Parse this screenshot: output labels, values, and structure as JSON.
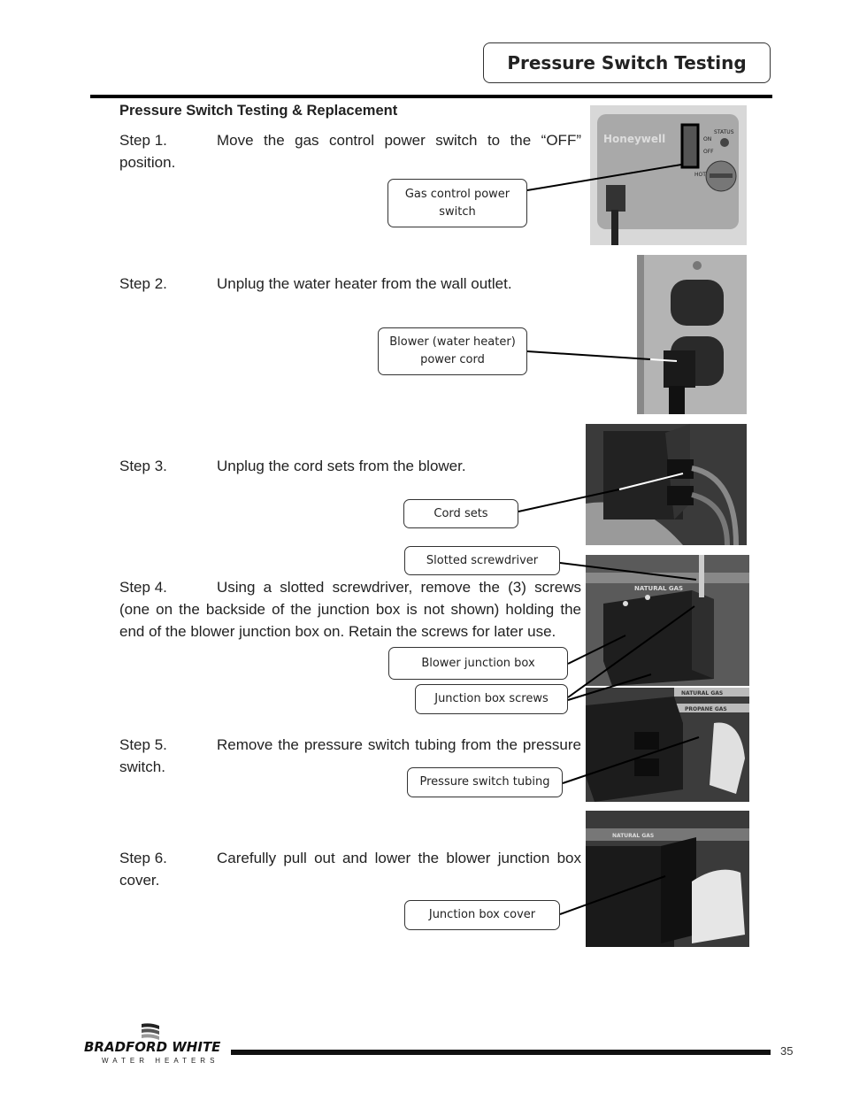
{
  "header": {
    "title": "Pressure Switch Testing"
  },
  "section": {
    "heading": "Pressure Switch Testing & Replacement"
  },
  "steps": [
    {
      "num": "Step 1.",
      "text": "Move the gas control power switch to the “OFF” position."
    },
    {
      "num": "Step 2.",
      "text": "Unplug the water heater from the wall outlet."
    },
    {
      "num": "Step 3.",
      "text": "Unplug the cord sets from the blower."
    },
    {
      "num": "Step 4.",
      "text": "Using a slotted screwdriver, remove the  (3) screws (one on the backside of the junction box is not shown) holding the end of the blower junction box on.  Retain the screws for later use."
    },
    {
      "num": "Step 5.",
      "text": "Remove the pressure switch tubing from the pressure switch."
    },
    {
      "num": "Step 6.",
      "text": "Carefully pull out and lower the blower junction box cover."
    }
  ],
  "callouts": {
    "gas_control_switch": "Gas control power switch",
    "blower_power_cord": "Blower (water heater) power cord",
    "cord_sets": "Cord sets",
    "slotted_screwdriver": "Slotted screwdriver",
    "blower_junction_box": "Blower junction box",
    "junction_box_screws": "Junction box screws",
    "pressure_switch_tubing": "Pressure switch tubing",
    "junction_box_cover": "Junction box cover"
  },
  "photo_labels": {
    "honeywell": "Honeywell",
    "on": "ON",
    "off": "OFF",
    "status": "STATUS",
    "hot": "HOT",
    "natural_gas": "NATURAL GAS",
    "propane_gas": "PROPANE GAS"
  },
  "footer": {
    "brand": "BRADFORD WHITE",
    "brand_sub": "WATER HEATERS",
    "page_number": "35"
  }
}
